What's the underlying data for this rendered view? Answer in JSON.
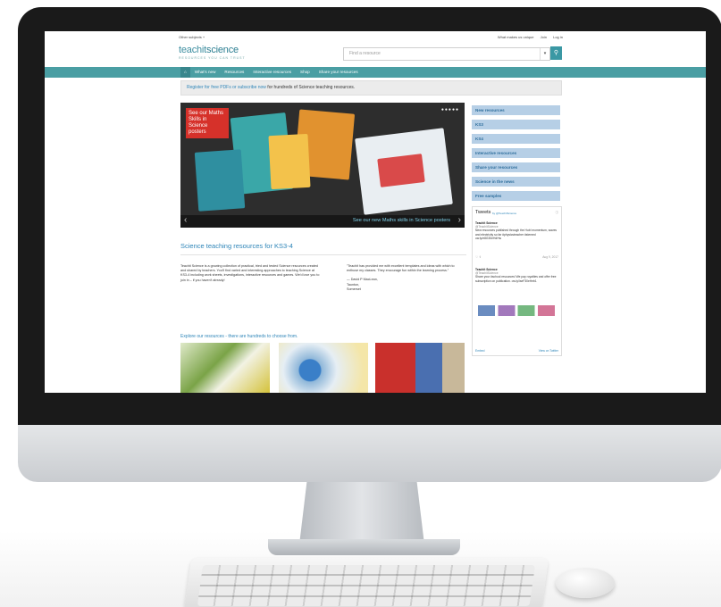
{
  "topbar": {
    "other_subjects": "Other subjects +",
    "links": [
      "What makes us unique",
      "Join",
      "Log in"
    ]
  },
  "header": {
    "logo_part1": "teachit",
    "logo_part2": "science",
    "tagline": "RESOURCES YOU CAN TRUST",
    "search_placeholder": "Find a resource",
    "search_icon": "search-icon"
  },
  "nav": {
    "home_icon": "home-icon",
    "items": [
      "What's new",
      "Resources",
      "Interactive resources",
      "Shop",
      "Share your resources"
    ]
  },
  "banner": {
    "link_text": "Register for free PDFs or subscribe now",
    "rest_text": " for hundreds of Science teaching resources."
  },
  "carousel": {
    "label": "See our Maths Skills in Science posters",
    "caption": "See our new Maths skills in Science posters",
    "dots": "●●●●●",
    "prev": "‹",
    "next": "›"
  },
  "sidebar": {
    "items": [
      "New resources",
      "KS3",
      "KS4",
      "Interactive resources",
      "Share your resources",
      "Science in the news",
      "Free samples"
    ]
  },
  "tweets": {
    "title": "Tweets",
    "by": "by @TeachitScience",
    "items": [
      {
        "name": "Teachit Science",
        "handle": "@TeachitScience",
        "text": "New resources published through the Hub! momentum, waves and electricity so far #physicsteacher #stemed ow.ly/e8G30eHdHw",
        "date": "Aug 9, 2017"
      },
      {
        "name": "Teachit Science",
        "handle": "@TeachitScience",
        "text": "Share your #school resources! We pay royalties and offer free subscription on publication. ow.ly/IseF30eHeb1"
      }
    ],
    "embed": "Embed",
    "view": "View on Twitter"
  },
  "content": {
    "heading": "Science teaching resources for KS3-4",
    "intro": "Teachit Science is a growing collection of practical, tried and tested Science resources created and shared by teachers. You'll find varied and interesting approaches to teaching Science at KS3-4 including work sheets, investigations, interactive resources and games. We'd love you to join in – if you haven't already!",
    "quote": "\"Teachit has provided me with excellent templates and ideas with which to enthuse my classes. They encourage fun within the learning process.\"",
    "author": "— David P MacLean,",
    "author_place1": "Taunton,",
    "author_place2": "Somerset",
    "explore": "Explore our resources - there are hundreds to choose from."
  }
}
